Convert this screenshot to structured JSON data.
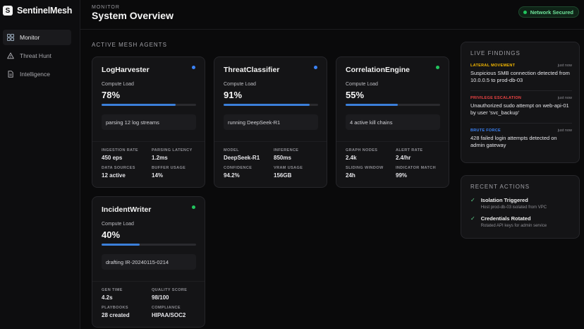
{
  "app": {
    "brand": "SentinelMesh",
    "logo_letter": "S"
  },
  "sidebar": {
    "items": [
      {
        "label": "Monitor",
        "icon": "grid-icon",
        "active": true
      },
      {
        "label": "Threat Hunt",
        "icon": "warning-icon",
        "active": false
      },
      {
        "label": "Intelligence",
        "icon": "document-icon",
        "active": false
      }
    ]
  },
  "header": {
    "eyebrow": "MONITOR",
    "title": "System Overview",
    "network_status": "Network Secured"
  },
  "section_label": "ACTIVE MESH AGENTS",
  "agents": [
    {
      "name": "LogHarvester",
      "status_color": "#3b82f6",
      "load_label": "Compute Load",
      "load_value": "78%",
      "load": 0.78,
      "task": "parsing 12 log streams",
      "stats": [
        {
          "k": "INGESTION RATE",
          "v": "450 eps"
        },
        {
          "k": "PARSING LATENCY",
          "v": "1.2ms"
        },
        {
          "k": "DATA SOURCES",
          "v": "12 active"
        },
        {
          "k": "BUFFER USAGE",
          "v": "14%"
        }
      ]
    },
    {
      "name": "ThreatClassifier",
      "status_color": "#3b82f6",
      "load_label": "Compute Load",
      "load_value": "91%",
      "load": 0.91,
      "task": "running DeepSeek-R1",
      "stats": [
        {
          "k": "MODEL",
          "v": "DeepSeek-R1"
        },
        {
          "k": "INFERENCE",
          "v": "850ms"
        },
        {
          "k": "CONFIDENCE",
          "v": "94.2%"
        },
        {
          "k": "VRAM USAGE",
          "v": "156GB"
        }
      ]
    },
    {
      "name": "CorrelationEngine",
      "status_color": "#22c55e",
      "load_label": "Compute Load",
      "load_value": "55%",
      "load": 0.55,
      "task": "4 active kill chains",
      "stats": [
        {
          "k": "GRAPH NODES",
          "v": "2.4k"
        },
        {
          "k": "ALERT RATE",
          "v": "2.4/hr"
        },
        {
          "k": "SLIDING WINDOW",
          "v": "24h"
        },
        {
          "k": "INDICATOR MATCH",
          "v": "99%"
        }
      ]
    },
    {
      "name": "IncidentWriter",
      "status_color": "#22c55e",
      "load_label": "Compute Load",
      "load_value": "40%",
      "load": 0.4,
      "task": "drafting IR-20240115-0214",
      "stats": [
        {
          "k": "GEN TIME",
          "v": "4.2s"
        },
        {
          "k": "QUALITY SCORE",
          "v": "98/100"
        },
        {
          "k": "PLAYBOOKS",
          "v": "28 created"
        },
        {
          "k": "COMPLIANCE",
          "v": "HIPAA/SOC2"
        }
      ]
    }
  ],
  "live_findings": {
    "title": "LIVE FINDINGS",
    "items": [
      {
        "category": "LATERAL MOVEMENT",
        "color": "#f5b800",
        "time": "just now",
        "text": "Suspicious SMB connection detected from 10.0.0.5 to prod-db-03"
      },
      {
        "category": "PRIVILEGE ESCALATION",
        "color": "#ef4444",
        "time": "just now",
        "text": "Unauthorized sudo attempt on web-api-01 by user 'svc_backup'"
      },
      {
        "category": "BRUTE FORCE",
        "color": "#3b82f6",
        "time": "just now",
        "text": "428 failed login attempts detected on admin gateway"
      }
    ]
  },
  "recent_actions": {
    "title": "RECENT ACTIONS",
    "items": [
      {
        "title": "Isolation Triggered",
        "desc": "Host prod-db-03 isolated from VPC"
      },
      {
        "title": "Credentials Rotated",
        "desc": "Rotated API keys for admin service"
      }
    ]
  },
  "colors": {
    "accent": "#3b7fd9",
    "secured": "#22c55e",
    "background": "#0a0a0b"
  }
}
